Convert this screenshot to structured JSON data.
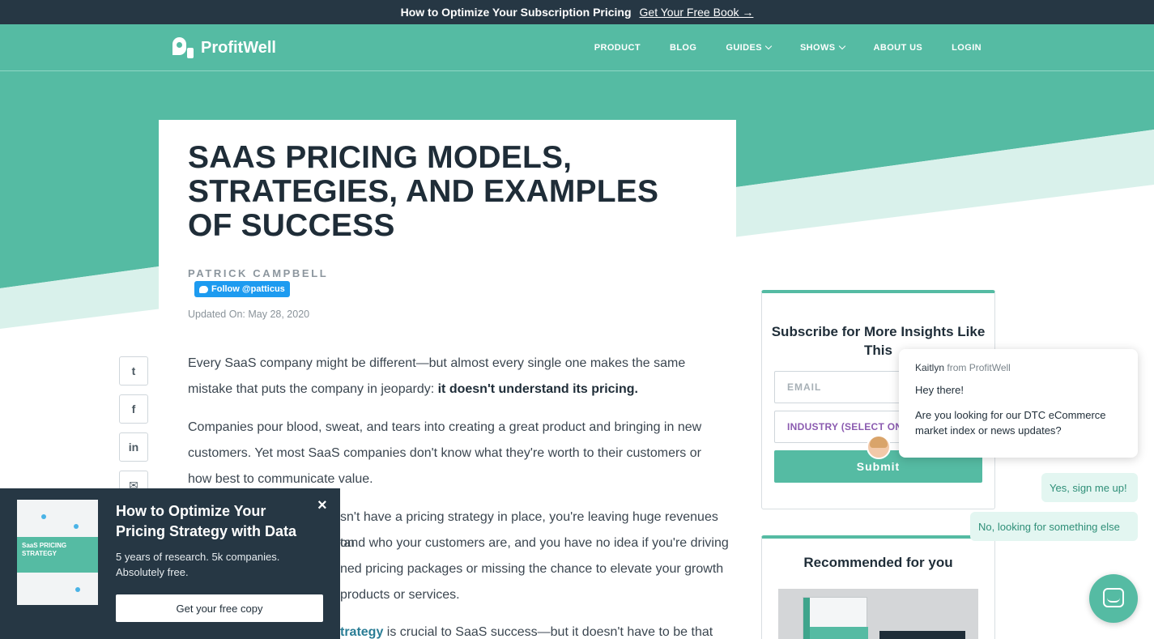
{
  "topbar": {
    "headline": "How to Optimize Your Subscription Pricing",
    "link": "Get Your Free Book →"
  },
  "nav": {
    "brand": "ProfitWell",
    "items": [
      "PRODUCT",
      "BLOG",
      "GUIDES",
      "SHOWS",
      "ABOUT US",
      "LOGIN"
    ]
  },
  "colors": {
    "brand_green": "#55bba3",
    "dark_navy": "#263744",
    "twitter_blue": "#1d9bf0"
  },
  "article": {
    "title": "SAAS PRICING MODELS, STRATEGIES, AND EXAMPLES OF SUCCESS",
    "author": "PATRICK CAMPBELL",
    "follow_label": "Follow @patticus",
    "updated": "Updated On: May 28, 2020",
    "p1_text": "Every SaaS company might be different—but almost every single one makes the same mistake that puts the company in jeopardy: ",
    "p1_bold": "it doesn't understand its pricing.",
    "p2": "Companies pour blood, sweat, and tears into creating a great product and bringing in new customers. Yet most SaaS companies don't know what they're worth to their customers or how best to communicate value.",
    "p3_l1": "sn't have a pricing strategy in place, you're leaving huge revenues on",
    "p3_l2": "tand who your customers are, and you have no idea if you're driving",
    "p3_l3": "ned pricing packages or missing the chance to elevate your growth",
    "p3_l4": "products or services.",
    "p4_link": "trategy",
    "p4_text": " is crucial to SaaS success—but it doesn't have to be that"
  },
  "share": {
    "icons": [
      "twitter-icon",
      "facebook-icon",
      "linkedin-icon",
      "email-icon"
    ],
    "labels": [
      "t",
      "f",
      "in",
      "✉"
    ]
  },
  "subscribe": {
    "title": "Subscribe for More Insights Like This",
    "email_placeholder": "EMAIL",
    "industry_placeholder": "INDUSTRY (SELECT ONE)",
    "submit": "Submit"
  },
  "recommended": {
    "title": "Recommended for you"
  },
  "chat": {
    "agent": "Kaitlyn",
    "from": " from ProfitWell",
    "greeting": "Hey there!",
    "question": "Are you looking for our DTC eCommerce market index or news updates?",
    "reply_yes": "Yes, sign me up!",
    "reply_no": "No, looking for something else"
  },
  "popup": {
    "close": "×",
    "headline": "How to Optimize Your Pricing Strategy with Data",
    "sub": "5 years of research. 5k companies. Absolutely free.",
    "cta": "Get your free copy",
    "cover_text": "SaaS PRICING STRATEGY"
  }
}
